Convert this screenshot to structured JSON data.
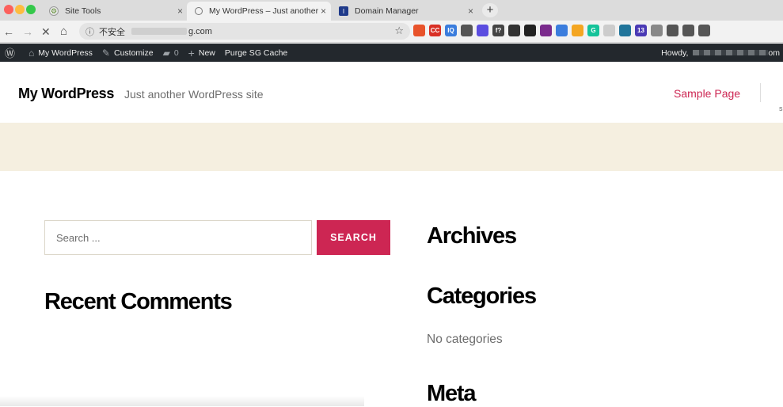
{
  "browser": {
    "tabs": [
      {
        "title": "Site Tools",
        "close": "×"
      },
      {
        "title": "My WordPress – Just another W",
        "close": "×"
      },
      {
        "title": "Domain Manager",
        "close": "×"
      }
    ],
    "new_tab": "+",
    "insecure_label": "不安全",
    "url_suffix": "g.com",
    "nav": {
      "back": "←",
      "forward": "→",
      "stop": "✕",
      "home": "⌂",
      "info": "ⓘ",
      "star": "☆"
    },
    "extensions": [
      {
        "label": "",
        "color": "#e8532b"
      },
      {
        "label": "CC",
        "color": "#d93025"
      },
      {
        "label": "IQ",
        "color": "#3b7ddd"
      },
      {
        "label": "",
        "color": "#555555"
      },
      {
        "label": "",
        "color": "#5b4de0"
      },
      {
        "label": "f?",
        "color": "#444444"
      },
      {
        "label": "",
        "color": "#333333"
      },
      {
        "label": "",
        "color": "#222222"
      },
      {
        "label": "",
        "color": "#7a2a8c"
      },
      {
        "label": "",
        "color": "#3b7ddd"
      },
      {
        "label": "",
        "color": "#f4a622"
      },
      {
        "label": "G",
        "color": "#15c39a"
      },
      {
        "label": "",
        "color": "#cccccc"
      },
      {
        "label": "",
        "color": "#21759b"
      },
      {
        "label": "13",
        "color": "#4a3ab5"
      },
      {
        "label": "",
        "color": "#888888"
      },
      {
        "label": "",
        "color": "#555555"
      },
      {
        "label": "",
        "color": "#555555"
      },
      {
        "label": "",
        "color": "#555555"
      }
    ]
  },
  "adminbar": {
    "site_name": "My WordPress",
    "customize": "Customize",
    "comments_count": "0",
    "new_label": "New",
    "purge": "Purge SG Cache",
    "howdy": "Howdy,",
    "howdy_suffix": "om"
  },
  "site": {
    "title": "My WordPress",
    "description": "Just another WordPress site",
    "menu_link": "Sample Page",
    "menu_fragment": "s"
  },
  "search": {
    "placeholder": "Search ...",
    "button": "SEARCH"
  },
  "widgets": {
    "archives": "Archives",
    "recent_comments": "Recent Comments",
    "categories": "Categories",
    "no_categories": "No categories",
    "meta": "Meta"
  }
}
